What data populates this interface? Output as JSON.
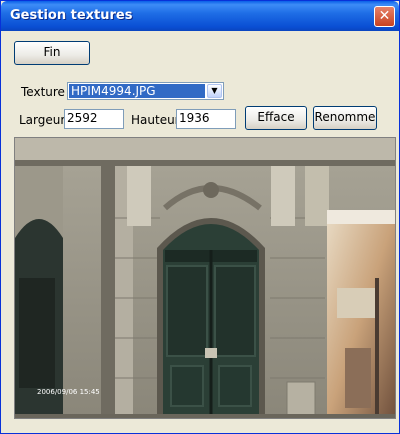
{
  "window": {
    "title": "Gestion textures",
    "close_icon": "close-icon"
  },
  "buttons": {
    "fin": "Fin",
    "efface": "Efface",
    "renomme": "Renomme"
  },
  "texture": {
    "label": "Texture",
    "selected": "HPIM4994.JPG"
  },
  "dimensions": {
    "largeur_label": "Largeur",
    "largeur_value": "2592",
    "hauteur_label": "Hauteur",
    "hauteur_value": "1936"
  },
  "photo": {
    "timestamp": "2006/09/06 15:45"
  },
  "colors": {
    "titlebar": "#0a4fd4",
    "selection": "#316ac5",
    "face": "#ece9d8",
    "door": "#2b3f36"
  }
}
